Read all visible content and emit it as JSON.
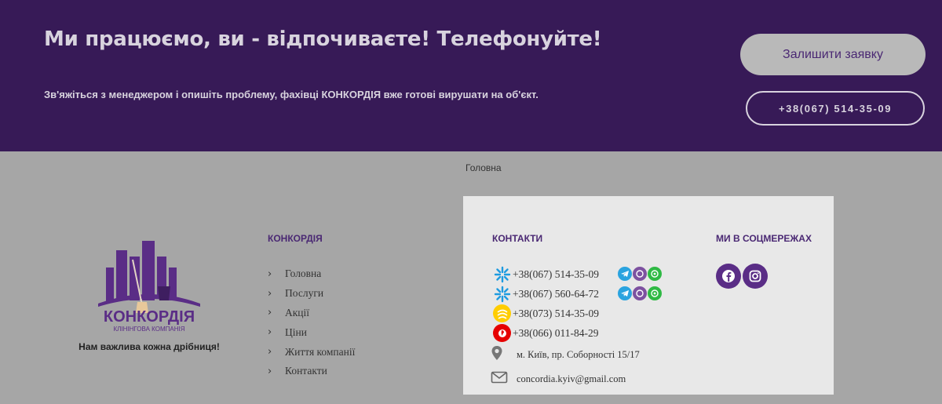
{
  "cta": {
    "title": "Ми працюємо, ви - відпочиваєте! Телефонуйте!",
    "subtitle": "Зв'яжіться з менеджером і опишіть проблему, фахівці КОНКОРДІЯ вже готові вирушати на об'єкт.",
    "request_button": "Залишити заявку",
    "phone_button": "+38(067) 514-35-09"
  },
  "breadcrumb": "Головна",
  "logo": {
    "name": "КОНКОРДІЯ",
    "subtitle": "КЛІНІНГОВА КОМПАНІЯ",
    "tagline": "Нам важлива кожна дрібниця!"
  },
  "menu": {
    "heading": "КОНКОРДІЯ",
    "items": [
      "Головна",
      "Послуги",
      "Акції",
      "Ціни",
      "Життя компанії",
      "Контакти"
    ]
  },
  "contacts": {
    "heading": "КОНТАКТИ",
    "phones": [
      {
        "number": "+38(067) 514-35-09",
        "operator": "kyivstar-icon"
      },
      {
        "number": "+38(067) 560-64-72",
        "operator": "kyivstar-icon"
      },
      {
        "number": "+38(073) 514-35-09",
        "operator": "lifecell-icon"
      },
      {
        "number": "+38(066) 011-84-29",
        "operator": "vodafone-icon"
      }
    ],
    "address": "м. Київ, пр. Соборності 15/17",
    "email": "concordia.kyiv@gmail.com"
  },
  "social": {
    "heading": "МИ В СОЦМЕРЕЖАХ",
    "icons": [
      "facebook-icon",
      "instagram-icon"
    ]
  },
  "colors": {
    "banner": "#371a57",
    "accent": "#4a2873",
    "footer": "#a6a6a6",
    "panel": "#e8e8e8"
  }
}
